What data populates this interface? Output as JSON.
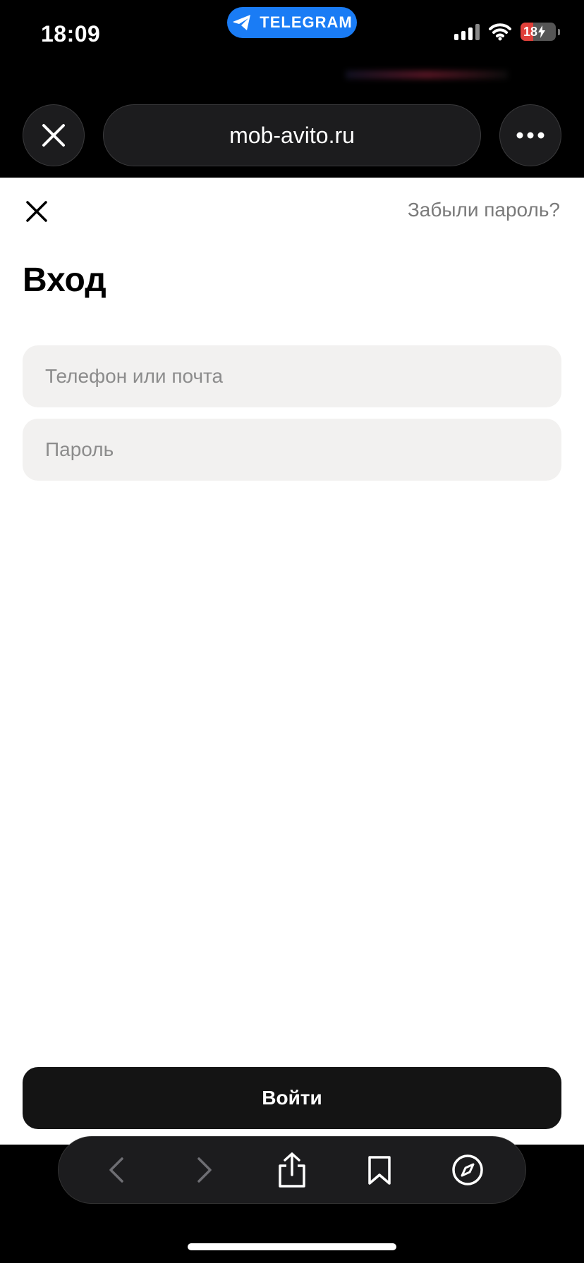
{
  "status_bar": {
    "time": "18:09",
    "pill_label": "TELEGRAM",
    "battery_percent": "18",
    "icons": [
      "telegram-icon",
      "signal-icon",
      "wifi-icon",
      "battery-charging-icon"
    ]
  },
  "browser": {
    "url": "mob-avito.ru",
    "icons": [
      "close-icon",
      "more-icon"
    ]
  },
  "page": {
    "forgot_password": "Забыли пароль?",
    "title": "Вход",
    "phone_field": {
      "placeholder": "Телефон или почта",
      "value": ""
    },
    "password_field": {
      "placeholder": "Пароль",
      "value": ""
    },
    "submit_label": "Войти"
  },
  "toolbar": {
    "icons": [
      "back-icon",
      "forward-icon",
      "share-icon",
      "bookmarks-icon",
      "compass-icon"
    ]
  },
  "colors": {
    "telegram_blue": "#1a7cf5",
    "button_dark": "#141414",
    "field_bg": "#f2f1f0",
    "battery_red": "#e0403a"
  }
}
